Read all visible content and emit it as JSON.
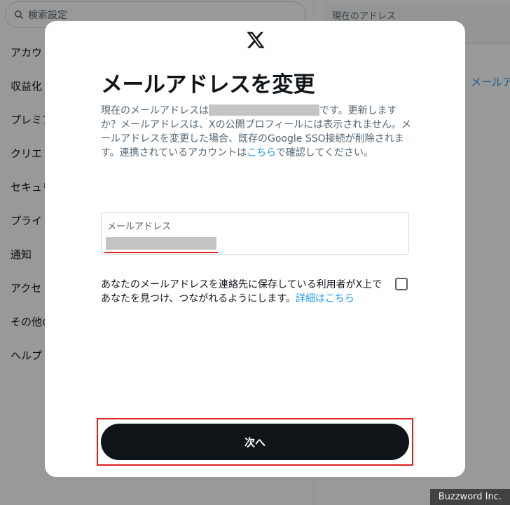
{
  "background": {
    "search_placeholder": "検索設定",
    "menu": [
      "アカウ",
      "収益化",
      "プレミア",
      "クリエ",
      "セキュリ",
      "プライ",
      "通知",
      "アクセ",
      "その他の",
      "ヘルプ"
    ],
    "current_address_label": "現在のアドレス",
    "change_email_link": "メールアドレ"
  },
  "modal": {
    "logo_icon": "x-logo-icon",
    "title": "メールアドレスを変更",
    "desc_part1": "現在のメールアドレスは",
    "desc_part2": "です。更新しますか？メールアドレスは、Xの公開プロフィールには表示されません。メールアドレスを変更した場合、既存のGoogle SSO接続が削除されます。連携されているアカウントは",
    "desc_link": "こちら",
    "desc_part3": "で確認してください。",
    "email_field_label": "メールアドレス",
    "consent_text": "あなたのメールアドレスを連絡先に保存している利用者がX上であなたを見つけ、つながれるようにします。",
    "consent_link": "詳細はこちら",
    "consent_checked": false,
    "next_button": "次へ"
  },
  "colors": {
    "accent_link": "#1d9bf0",
    "primary_button": "#0f1419",
    "annotation_red": "#e0201b"
  },
  "watermark": "Buzzword Inc."
}
